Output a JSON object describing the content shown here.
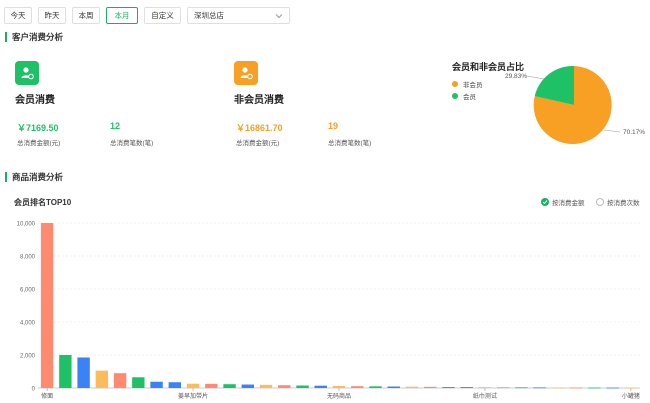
{
  "toolbar": {
    "buttons": [
      "今天",
      "昨天",
      "本周",
      "本月",
      "自定义"
    ],
    "active_index": 3,
    "store_select": "深圳总店"
  },
  "customer_section": {
    "title": "客户消费分析",
    "member": {
      "title": "会员消费",
      "amount": "￥7169.50",
      "amount_label": "总消费金额(元)",
      "count": "12",
      "count_label": "总消费笔数(笔)"
    },
    "non_member": {
      "title": "非会员消费",
      "amount": "￥16861.70",
      "amount_label": "总消费金额(元)",
      "count": "19",
      "count_label": "总消费笔数(笔)"
    },
    "pie": {
      "title": "会员和非会员占比",
      "legend": [
        {
          "label": "非会员",
          "color": "#f7a023"
        },
        {
          "label": "会员",
          "color": "#1fc167"
        }
      ],
      "member_pct_label": "29.83%",
      "non_member_pct_label": "70.17%"
    }
  },
  "product_section": {
    "title": "商品消费分析",
    "rank_title": "会员排名TOP10",
    "radio_amount": "按消费金额",
    "radio_count": "按消费次数"
  },
  "chart_data": {
    "type": "bar",
    "ylim": [
      0,
      10000
    ],
    "yticks": [
      "0",
      "2,000",
      "4,000",
      "6,000",
      "8,000",
      "10,000"
    ],
    "categories": [
      "修面",
      "",
      "",
      "",
      "",
      "",
      "",
      "",
      "姜早加带片",
      "",
      "",
      "",
      "",
      "",
      "",
      "",
      "无码商品",
      "",
      "",
      "",
      "",
      "",
      "",
      "",
      "纸巾测试",
      "",
      "",
      "",
      "",
      "",
      "",
      "",
      "小罐猪"
    ],
    "x_tick_labels": [
      "修面",
      "姜早加带片",
      "无码商品",
      "纸巾测试",
      "小罐猪"
    ],
    "values": [
      10000,
      2000,
      1850,
      1050,
      900,
      650,
      380,
      350,
      260,
      250,
      230,
      210,
      190,
      170,
      150,
      140,
      120,
      110,
      100,
      90,
      80,
      70,
      60,
      55,
      50,
      45,
      40,
      35,
      30,
      28,
      25,
      22,
      20
    ],
    "colors": [
      "#ff8a70",
      "#1fc167",
      "#3b82f6",
      "#fdbb5a",
      "#ff8a70",
      "#1fc167",
      "#3b82f6",
      "#3b82f6",
      "#fdbb5a",
      "#ff8a70",
      "#1fc167",
      "#3b82f6",
      "#fdbb5a",
      "#ff8a70",
      "#1fc167",
      "#3b82f6",
      "#fdbb5a",
      "#ff8a70",
      "#1fc167",
      "#3b82f6",
      "#fdbb5a",
      "#ff8a70",
      "#1fc167",
      "#3b82f6",
      "#fdbb5a",
      "#ff8a70",
      "#1fc167",
      "#3b82f6",
      "#fdbb5a",
      "#ff8a70",
      "#1fc167",
      "#3b82f6",
      "#fdbb5a"
    ]
  }
}
